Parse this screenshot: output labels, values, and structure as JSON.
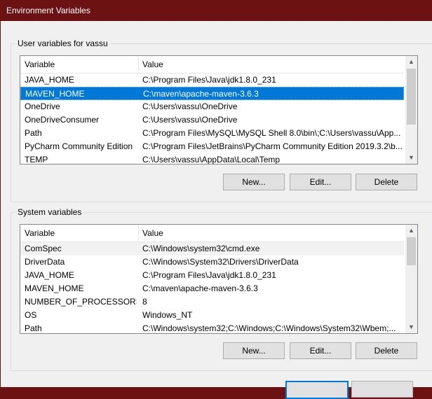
{
  "window": {
    "title": "Environment Variables"
  },
  "user_vars": {
    "group_label": "User variables for vassu",
    "columns": [
      "Variable",
      "Value"
    ],
    "rows": [
      {
        "name": "JAVA_HOME",
        "value": "C:\\Program Files\\Java\\jdk1.8.0_231"
      },
      {
        "name": "MAVEN_HOME",
        "value": "C:\\maven\\apache-maven-3.6.3"
      },
      {
        "name": "OneDrive",
        "value": "C:\\Users\\vassu\\OneDrive"
      },
      {
        "name": "OneDriveConsumer",
        "value": "C:\\Users\\vassu\\OneDrive"
      },
      {
        "name": "Path",
        "value": "C:\\Program Files\\MySQL\\MySQL Shell 8.0\\bin\\;C:\\Users\\vassu\\App..."
      },
      {
        "name": "PyCharm Community Edition",
        "value": "C:\\Program Files\\JetBrains\\PyCharm Community Edition 2019.3.2\\b..."
      },
      {
        "name": "TEMP",
        "value": "C:\\Users\\vassu\\AppData\\Local\\Temp"
      }
    ],
    "buttons": {
      "new": "New...",
      "edit": "Edit...",
      "delete": "Delete"
    }
  },
  "system_vars": {
    "group_label": "System variables",
    "columns": [
      "Variable",
      "Value"
    ],
    "rows": [
      {
        "name": "ComSpec",
        "value": "C:\\Windows\\system32\\cmd.exe"
      },
      {
        "name": "DriverData",
        "value": "C:\\Windows\\System32\\Drivers\\DriverData"
      },
      {
        "name": "JAVA_HOME",
        "value": "C:\\Program Files\\Java\\jdk1.8.0_231"
      },
      {
        "name": "MAVEN_HOME",
        "value": "C:\\maven\\apache-maven-3.6.3"
      },
      {
        "name": "NUMBER_OF_PROCESSORS",
        "value": "8"
      },
      {
        "name": "OS",
        "value": "Windows_NT"
      },
      {
        "name": "Path",
        "value": "C:\\Windows\\system32;C:\\Windows;C:\\Windows\\System32\\Wbem;..."
      }
    ],
    "buttons": {
      "new": "New...",
      "edit": "Edit...",
      "delete": "Delete"
    }
  },
  "icons": {
    "scroll_up": "scroll-up-arrow-icon",
    "scroll_down": "scroll-down-arrow-icon"
  }
}
